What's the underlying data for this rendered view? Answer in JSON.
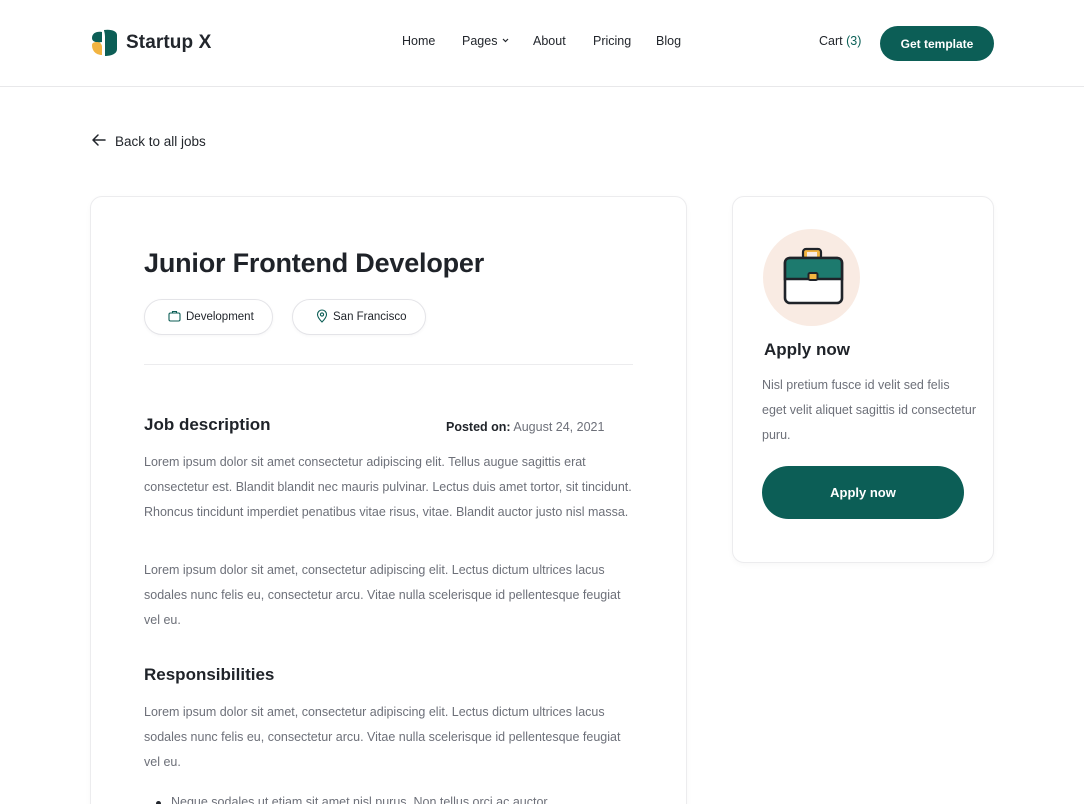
{
  "header": {
    "logo_text": "Startup X",
    "nav": [
      {
        "label": "Home"
      },
      {
        "label": "Pages"
      },
      {
        "label": "About"
      },
      {
        "label": "Pricing"
      },
      {
        "label": "Blog"
      }
    ],
    "cart_label": "Cart",
    "cart_count": "(3)",
    "cta_label": "Get template"
  },
  "back_link": "Back to all jobs",
  "job": {
    "title": "Junior Frontend Developer",
    "tags": [
      {
        "label": "Development",
        "icon": "briefcase-icon"
      },
      {
        "label": "San Francisco",
        "icon": "location-pin-icon"
      }
    ],
    "description_title": "Job description",
    "posted_label": "Posted on",
    "posted_date": "August 24, 2021",
    "description_paragraphs": [
      "Lorem ipsum dolor sit amet consectetur adipiscing elit. Tellus augue sagittis erat consectetur est. Blandit blandit nec mauris pulvinar. Lectus duis amet tortor, sit tincidunt. Rhoncus tincidunt imperdiet penatibus vitae risus, vitae. Blandit auctor justo nisl massa.",
      "Lorem ipsum dolor sit amet, consectetur adipiscing elit. Lectus dictum ultrices lacus sodales nunc felis eu, consectetur arcu. Vitae nulla scelerisque id pellentesque feugiat vel eu."
    ],
    "responsibilities_title": "Responsibilities",
    "responsibilities_paragraph": "Lorem ipsum dolor sit amet, consectetur adipiscing elit. Lectus dictum ultrices lacus sodales nunc felis eu, consectetur arcu. Vitae nulla scelerisque id pellentesque feugiat vel eu.",
    "responsibilities_bullets": [
      "Neque sodales ut etiam sit amet nisl purus. Non tellus orci ac auctor"
    ]
  },
  "apply": {
    "icon": "briefcase-icon",
    "title": "Apply now",
    "text": "Nisl pretium fusce id velit sed felis eget velit aliquet sagittis id consectetur puru.",
    "button_label": "Apply now"
  },
  "colors": {
    "brand": "#0c5e56",
    "accent_orange": "#f2a93b",
    "icon_bg": "#f9ebe3"
  }
}
